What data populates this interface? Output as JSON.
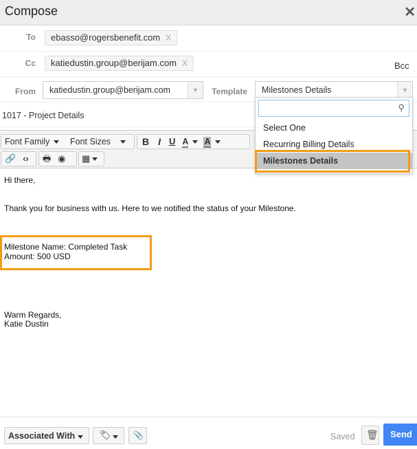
{
  "window": {
    "title": "Compose",
    "close_icon": "close-icon"
  },
  "recipients": {
    "to_label": "To",
    "to_chips": [
      {
        "email": "ebasso@rogersbenefit.com",
        "remove": "X"
      }
    ],
    "cc_label": "Cc",
    "cc_chips": [
      {
        "email": "katiedustin.group@berijam.com",
        "remove": "X"
      }
    ],
    "bcc_label": "Bcc"
  },
  "from": {
    "label": "From",
    "value": "katiedustin.group@berijam.com"
  },
  "template": {
    "label": "Template",
    "value": "Milestones Details",
    "search_placeholder": "",
    "options": [
      {
        "label": "Select One",
        "selected": false
      },
      {
        "label": "Recurring Billing Details",
        "selected": false
      },
      {
        "label": "Milestones Details",
        "selected": true
      }
    ]
  },
  "subject": "1017  - Project Details",
  "toolbar": {
    "font_family": "Font Family",
    "font_sizes": "Font Sizes",
    "bold": "B",
    "italic": "I",
    "underline": "U",
    "text_color": "A",
    "bg_color": "A"
  },
  "body": {
    "greeting": "Hi there,",
    "intro": "Thank you for business with us. Here to we notified the status of your Milestone.",
    "milestone_line": " Milestone Name: Completed Task",
    "amount_line": "Amount: 500 USD",
    "closing": "Warm Regards,",
    "signature": "Katie  Dustin"
  },
  "footer": {
    "associated_with": "Associated With",
    "saved": "Saved",
    "send": "Send"
  },
  "colors": {
    "highlight": "#f39c12",
    "send": "#4285f4"
  }
}
